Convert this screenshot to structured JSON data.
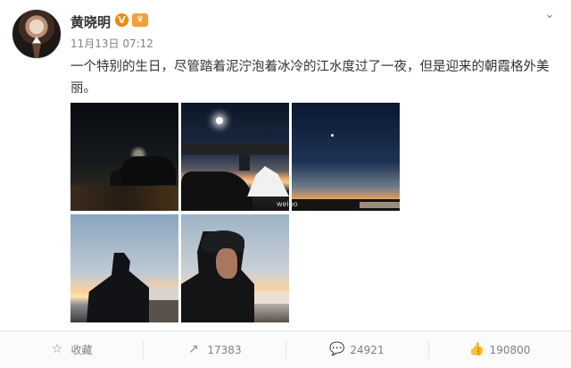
{
  "post": {
    "username": "黄晓明",
    "verified_badge": "V",
    "time": "11月13日 07:12",
    "content": "一个特别的生日，尽管踏着泥泞泡着冰冷的江水度过了一夜，但是迎来的朝霞格外美丽。",
    "menu_icon": "chevron-down-icon"
  },
  "images": [
    {
      "name": "night-riverside-crowd"
    },
    {
      "name": "bridge-sunrise-campsite"
    },
    {
      "name": "dawn-sky-star"
    },
    {
      "name": "man-in-black-beanie-profile"
    },
    {
      "name": "man-closeup-sunrise"
    }
  ],
  "actions": {
    "favorite_label": "收藏",
    "share_count": "17383",
    "comment_count": "24921",
    "like_count": "190800"
  },
  "colors": {
    "accent": "#ff8200",
    "text": "#333333",
    "muted": "#808080"
  }
}
